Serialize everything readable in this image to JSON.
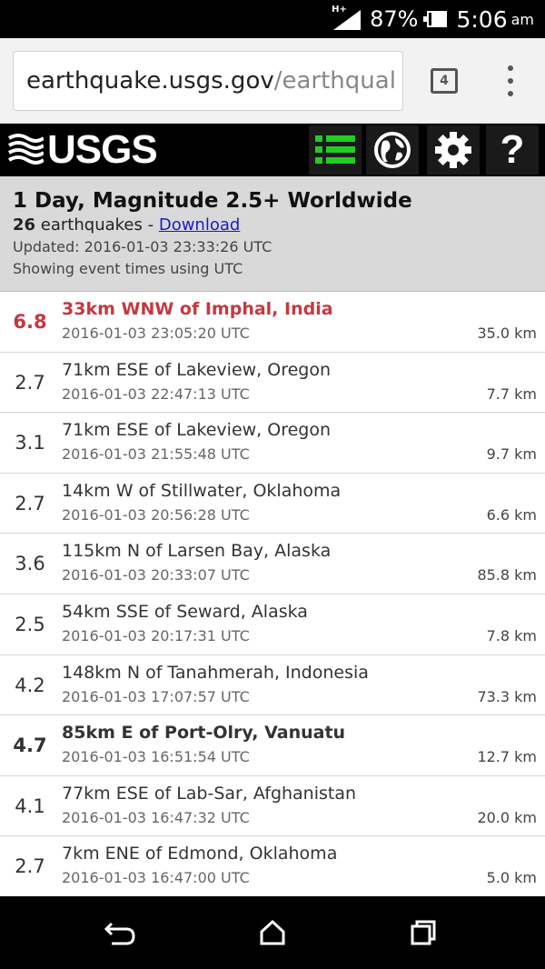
{
  "status_bar": {
    "network": "H+",
    "battery": "87%",
    "battery_level": 0.87,
    "time": "5:06",
    "ampm": "am"
  },
  "browser": {
    "url_domain": "earthquake.usgs.gov",
    "url_path": "/earthqual",
    "tab_count": "4"
  },
  "app": {
    "logo": "USGS"
  },
  "summary": {
    "title": "1 Day, Magnitude 2.5+ Worldwide",
    "count": "26",
    "count_label": "earthquakes",
    "separator": " - ",
    "download": "Download",
    "updated": "Updated: 2016-01-03 23:33:26 UTC",
    "timezone_note": "Showing event times using UTC"
  },
  "earthquakes": [
    {
      "mag": "6.8",
      "place": "33km WNW of Imphal, India",
      "time": "2016-01-03 23:05:20 UTC",
      "depth": "35.0 km",
      "style": "red"
    },
    {
      "mag": "2.7",
      "place": "71km ESE of Lakeview, Oregon",
      "time": "2016-01-03 22:47:13 UTC",
      "depth": "7.7 km",
      "style": "normal"
    },
    {
      "mag": "3.1",
      "place": "71km ESE of Lakeview, Oregon",
      "time": "2016-01-03 21:55:48 UTC",
      "depth": "9.7 km",
      "style": "normal"
    },
    {
      "mag": "2.7",
      "place": "14km W of Stillwater, Oklahoma",
      "time": "2016-01-03 20:56:28 UTC",
      "depth": "6.6 km",
      "style": "normal"
    },
    {
      "mag": "3.6",
      "place": "115km N of Larsen Bay, Alaska",
      "time": "2016-01-03 20:33:07 UTC",
      "depth": "85.8 km",
      "style": "normal"
    },
    {
      "mag": "2.5",
      "place": "54km SSE of Seward, Alaska",
      "time": "2016-01-03 20:17:31 UTC",
      "depth": "7.8 km",
      "style": "normal"
    },
    {
      "mag": "4.2",
      "place": "148km N of Tanahmerah, Indonesia",
      "time": "2016-01-03 17:07:57 UTC",
      "depth": "73.3 km",
      "style": "normal"
    },
    {
      "mag": "4.7",
      "place": "85km E of Port-Olry, Vanuatu",
      "time": "2016-01-03 16:51:54 UTC",
      "depth": "12.7 km",
      "style": "big"
    },
    {
      "mag": "4.1",
      "place": "77km ESE of Lab-Sar, Afghanistan",
      "time": "2016-01-03 16:47:32 UTC",
      "depth": "20.0 km",
      "style": "normal"
    },
    {
      "mag": "2.7",
      "place": "7km ENE of Edmond, Oklahoma",
      "time": "2016-01-03 16:47:00 UTC",
      "depth": "5.0 km",
      "style": "normal"
    }
  ],
  "icons": {
    "header": [
      "list-icon",
      "globe-icon",
      "gear-icon",
      "help-icon"
    ],
    "nav": [
      "back-icon",
      "home-icon",
      "recents-icon"
    ]
  },
  "colors": {
    "accent_green": "#22cc22",
    "major_quake": "#c5383f",
    "link": "#1a1acc",
    "summary_bg": "#d9d9d9"
  }
}
